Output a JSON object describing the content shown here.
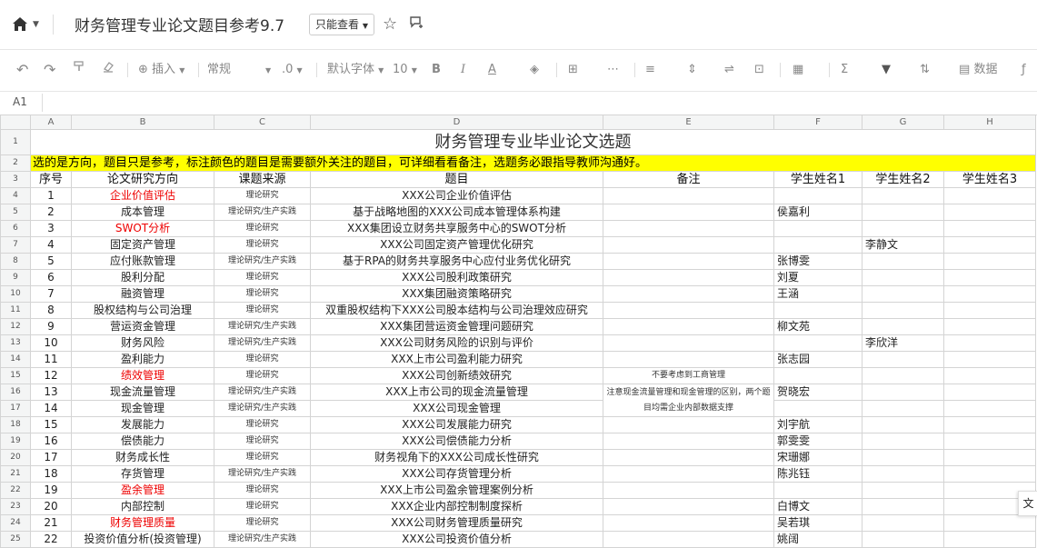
{
  "titlebar": {
    "doc_title": "财务管理专业论文题目参考9.7",
    "permission": "只能查看"
  },
  "toolbar": {
    "insert": "插入",
    "format": "常规",
    "decimal": ".0",
    "font": "默认字体",
    "size": "10",
    "data": "数据"
  },
  "formula_bar": {
    "cell_ref": "A1"
  },
  "columns": [
    "A",
    "B",
    "C",
    "D",
    "E",
    "F",
    "G",
    "H"
  ],
  "sheet": {
    "title": "财务管理专业毕业论文选题",
    "note": "选的是方向，题目只是参考，标注颜色的题目是需要额外关注的题目，可详细看看备注，选题务必跟指导教师沟通好。",
    "headers": [
      "序号",
      "论文研究方向",
      "课题来源",
      "题目",
      "备注",
      "学生姓名1",
      "学生姓名2",
      "学生姓名3"
    ],
    "remark_merged": "注意现金流量管理和现金管理的区别，两个题目均需企业内部数据支撑",
    "rows": [
      {
        "rn": "4",
        "no": "1",
        "dir": "企业价值评估",
        "src": "理论研究",
        "topic": "XXX公司企业价值评估",
        "note": "",
        "s1": "",
        "s2": ""
      },
      {
        "rn": "5",
        "no": "2",
        "dir": "成本管理",
        "src": "理论研究/生产实践",
        "topic": "基于战略地图的XXX公司成本管理体系构建",
        "note": "",
        "s1": "侯嘉利",
        "s2": ""
      },
      {
        "rn": "6",
        "no": "3",
        "dir": "SWOT分析",
        "src": "理论研究",
        "topic": "XXX集团设立财务共享服务中心的SWOT分析",
        "note": "",
        "s1": "",
        "s2": ""
      },
      {
        "rn": "7",
        "no": "4",
        "dir": "固定资产管理",
        "src": "理论研究",
        "topic": "XXX公司固定资产管理优化研究",
        "note": "",
        "s1": "",
        "s2": "李静文"
      },
      {
        "rn": "8",
        "no": "5",
        "dir": "应付账款管理",
        "src": "理论研究/生产实践",
        "topic": "基于RPA的财务共享服务中心应付业务优化研究",
        "note": "",
        "s1": "张博雯",
        "s2": ""
      },
      {
        "rn": "9",
        "no": "6",
        "dir": "股利分配",
        "src": "理论研究",
        "topic": "XXX公司股利政策研究",
        "note": "",
        "s1": "刘夏",
        "s2": ""
      },
      {
        "rn": "10",
        "no": "7",
        "dir": "融资管理",
        "src": "理论研究",
        "topic": "XXX集团融资策略研究",
        "note": "",
        "s1": "王涵",
        "s2": ""
      },
      {
        "rn": "11",
        "no": "8",
        "dir": "股权结构与公司治理",
        "src": "理论研究",
        "topic": "双重股权结构下XXX公司股本结构与公司治理效应研究",
        "note": "",
        "s1": "",
        "s2": ""
      },
      {
        "rn": "12",
        "no": "9",
        "dir": "营运资金管理",
        "src": "理论研究/生产实践",
        "topic": "XXX集团营运资金管理问题研究",
        "note": "",
        "s1": "柳文苑",
        "s2": ""
      },
      {
        "rn": "13",
        "no": "10",
        "dir": "财务风险",
        "src": "理论研究/生产实践",
        "topic": "XXX公司财务风险的识别与评价",
        "note": "",
        "s1": "",
        "s2": "李欣洋"
      },
      {
        "rn": "14",
        "no": "11",
        "dir": "盈利能力",
        "src": "理论研究",
        "topic": "XXX上市公司盈利能力研究",
        "note": "",
        "s1": "张志园",
        "s2": ""
      },
      {
        "rn": "15",
        "no": "12",
        "dir": "绩效管理",
        "src": "理论研究",
        "topic": "XXX公司创新绩效研究",
        "note": "不要考虑到工商管理",
        "s1": "",
        "s2": ""
      },
      {
        "rn": "16",
        "no": "13",
        "dir": "现金流量管理",
        "src": "理论研究/生产实践",
        "topic": "XXX上市公司的现金流量管理",
        "note": "",
        "s1": "贺晓宏",
        "s2": ""
      },
      {
        "rn": "17",
        "no": "14",
        "dir": "现金管理",
        "src": "理论研究/生产实践",
        "topic": "XXX公司现金管理",
        "note": "",
        "s1": "",
        "s2": ""
      },
      {
        "rn": "18",
        "no": "15",
        "dir": "发展能力",
        "src": "理论研究",
        "topic": "XXX公司发展能力研究",
        "note": "",
        "s1": "刘宇航",
        "s2": ""
      },
      {
        "rn": "19",
        "no": "16",
        "dir": "偿债能力",
        "src": "理论研究",
        "topic": "XXX公司偿债能力分析",
        "note": "",
        "s1": "郭雯雯",
        "s2": ""
      },
      {
        "rn": "20",
        "no": "17",
        "dir": "财务成长性",
        "src": "理论研究",
        "topic": "财务视角下的XXX公司成长性研究",
        "note": "",
        "s1": "宋珊娜",
        "s2": ""
      },
      {
        "rn": "21",
        "no": "18",
        "dir": "存货管理",
        "src": "理论研究/生产实践",
        "topic": "XXX公司存货管理分析",
        "note": "",
        "s1": "陈兆钰",
        "s2": ""
      },
      {
        "rn": "22",
        "no": "19",
        "dir": "盈余管理",
        "src": "理论研究",
        "topic": "XXX上市公司盈余管理案例分析",
        "note": "",
        "s1": "",
        "s2": ""
      },
      {
        "rn": "23",
        "no": "20",
        "dir": "内部控制",
        "src": "理论研究",
        "topic": "XXX企业内部控制制度探析",
        "note": "",
        "s1": "白博文",
        "s2": ""
      },
      {
        "rn": "24",
        "no": "21",
        "dir": "财务管理质量",
        "src": "理论研究",
        "topic": "XXX公司财务管理质量研究",
        "note": "",
        "s1": "吴若琪",
        "s2": ""
      },
      {
        "rn": "25",
        "no": "22",
        "dir": "投资价值分析(投资管理)",
        "src": "理论研究/生产实践",
        "topic": "XXX公司投资价值分析",
        "note": "",
        "s1": "姚阔",
        "s2": ""
      }
    ]
  },
  "side_tab": "文",
  "colors": {
    "highlight": "#ffff00",
    "accent_red": "#e00000"
  }
}
